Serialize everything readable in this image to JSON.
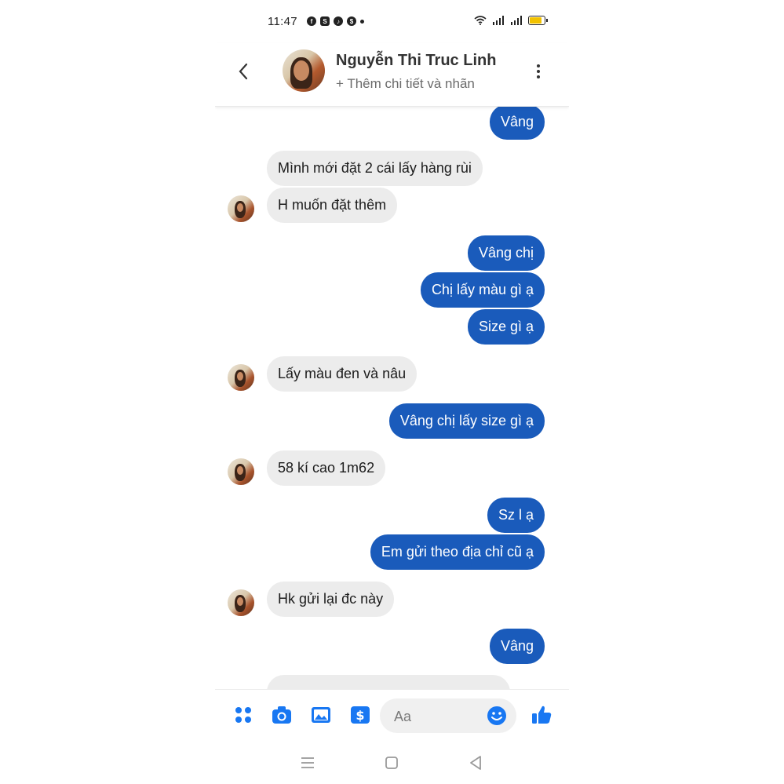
{
  "status_bar": {
    "time": "11:47"
  },
  "header": {
    "name": "Nguyễn Thi Truc Linh",
    "subtitle": "+ Thêm chi tiết và nhãn"
  },
  "messages": [
    {
      "dir": "out",
      "text": "Vâng"
    },
    {
      "dir": "in",
      "text": "Mình mới đặt 2 cái lấy hàng rùi"
    },
    {
      "dir": "in",
      "text": "H muốn đặt thêm"
    },
    {
      "dir": "out",
      "text": "Vâng chị"
    },
    {
      "dir": "out",
      "text": "Chị lấy màu gì ạ"
    },
    {
      "dir": "out",
      "text": "Size gì ạ"
    },
    {
      "dir": "in",
      "text": "Lấy màu đen và nâu"
    },
    {
      "dir": "out",
      "text": "Vâng chị lấy size gì ạ"
    },
    {
      "dir": "in",
      "text": "58 kí cao 1m62"
    },
    {
      "dir": "out",
      "text": "Sz l ạ"
    },
    {
      "dir": "out",
      "text": "Em gửi theo địa chỉ cũ ạ"
    },
    {
      "dir": "in",
      "text": "Hk gửi lại đc này"
    },
    {
      "dir": "out",
      "text": "Vâng"
    }
  ],
  "composer": {
    "placeholder": "Aa"
  },
  "colors": {
    "outgoing": "#1a5bbb",
    "incoming": "#ececec",
    "accent": "#1877f2"
  },
  "icons": {
    "toolbar": [
      "menu-grid-icon",
      "camera-icon",
      "gallery-icon",
      "payment-icon",
      "emoji-icon",
      "like-thumb-icon"
    ],
    "nav": [
      "recent-apps-icon",
      "home-icon",
      "back-icon"
    ]
  }
}
